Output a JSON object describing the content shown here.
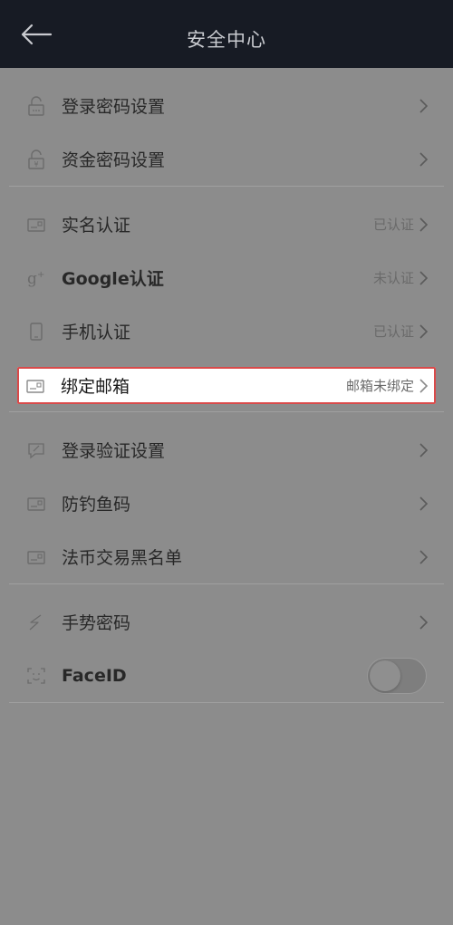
{
  "header": {
    "title": "安全中心"
  },
  "groups": [
    {
      "items": [
        {
          "label": "登录密码设置",
          "status": ""
        },
        {
          "label": "资金密码设置",
          "status": ""
        }
      ]
    },
    {
      "items": [
        {
          "label": "实名认证",
          "status": "已认证"
        },
        {
          "label": "Google认证",
          "status": "未认证"
        },
        {
          "label": "手机认证",
          "status": "已认证"
        },
        {
          "label": "绑定邮箱",
          "status": "邮箱未绑定"
        }
      ]
    },
    {
      "items": [
        {
          "label": "登录验证设置",
          "status": ""
        },
        {
          "label": "防钓鱼码",
          "status": ""
        },
        {
          "label": "法币交易黑名单",
          "status": ""
        }
      ]
    },
    {
      "items": [
        {
          "label": "手势密码",
          "status": ""
        },
        {
          "label": "FaceID",
          "toggle": false
        }
      ]
    }
  ],
  "icons": {
    "back": "arrow-left-icon",
    "lock": "lock-icon",
    "card": "id-card-icon",
    "google": "google-plus-icon",
    "phone": "phone-icon",
    "verify": "verify-icon",
    "gesture": "gesture-icon",
    "face": "face-id-icon",
    "chevron": "chevron-right-icon"
  },
  "colors": {
    "header_bg": "#171b24",
    "page_bg": "#8c8c8c",
    "highlight_border": "#d94a4a"
  }
}
